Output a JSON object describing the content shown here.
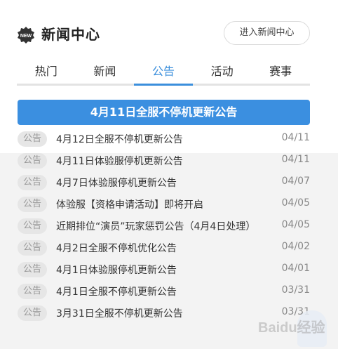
{
  "header": {
    "badge_text": "NEW",
    "title": "新闻中心",
    "enter_button": "进入新闻中心"
  },
  "tabs": [
    {
      "label": "热门",
      "active": false
    },
    {
      "label": "新闻",
      "active": false
    },
    {
      "label": "公告",
      "active": true
    },
    {
      "label": "活动",
      "active": false
    },
    {
      "label": "赛事",
      "active": false
    }
  ],
  "featured": {
    "title": "4月11日全服不停机更新公告"
  },
  "news": [
    {
      "tag": "公告",
      "title": "4月12日全服不停机更新公告",
      "date": "04/11"
    },
    {
      "tag": "公告",
      "title": "4月11日体验服停机更新公告",
      "date": "04/11"
    },
    {
      "tag": "公告",
      "title": "4月7日体验服停机更新公告",
      "date": "04/07"
    },
    {
      "tag": "公告",
      "title": "体验服【资格申请活动】即将开启",
      "date": "04/05"
    },
    {
      "tag": "公告",
      "title": "近期排位“演员”玩家惩罚公告（4月4日处理）",
      "date": "04/05"
    },
    {
      "tag": "公告",
      "title": "4月2日全服不停机优化公告",
      "date": "04/02"
    },
    {
      "tag": "公告",
      "title": "4月1日体验服停机更新公告",
      "date": "04/01"
    },
    {
      "tag": "公告",
      "title": "4月1日全服不停机更新公告",
      "date": "03/31"
    },
    {
      "tag": "公告",
      "title": "3月31日全服不停机更新公告",
      "date": "03/31"
    }
  ],
  "watermark": {
    "text": "Baidu经验"
  },
  "colors": {
    "accent": "#3b8fdc",
    "featured_bg": "#3b8fe0",
    "badge_bg": "#e6e6e6",
    "tab_underline": "#e3e3e3"
  }
}
